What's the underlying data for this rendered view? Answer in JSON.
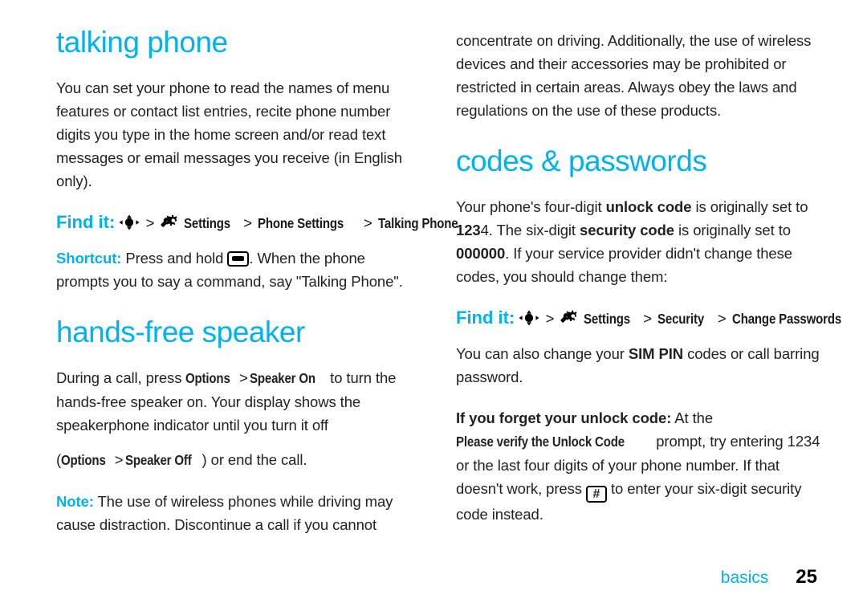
{
  "page": {
    "footer_label": "basics",
    "page_number": "25",
    "accent_color": "#00b2f0",
    "text_color": "#222222"
  },
  "left_column": {
    "heading_talking_phone": "talking phone",
    "intro_paragraph": "You can set your phone to read the names of menu features or contact list entries, recite phone number digits you type in the home screen and/or read text messages or email messages you receive (in English only).",
    "find_it": {
      "label": "Find it:",
      "dpad_icon": "dpad-navigation-icon",
      "sep1": ">",
      "settings_icon": "settings-wrench-gear-icon",
      "item_settings": "Settings",
      "sep2": ">",
      "item_phone_settings": "Phone Settings",
      "sep3": ">",
      "item_talking_phone": "Talking Phone"
    },
    "shortcut": {
      "label": "Shortcut:",
      "text_before": "Press and hold",
      "key_icon": "phone-bar-key-icon",
      "text_after": ". When the phone prompts you to say a command, say \"Talking Phone\"."
    },
    "heading_hands_free": "hands-free speaker",
    "hands_free": {
      "part1": "During a call, press ",
      "menu_options": "Options",
      "sep1": ">",
      "menu_speaker_on": "Speaker On",
      "part2": " to turn the hands-free speaker on. Your display shows the speakerphone indicator until you turn it off"
    },
    "speaker_off_line": {
      "open_paren": "(",
      "menu_options": "Options",
      "sep": ">",
      "menu_speaker_off": "Speaker Off",
      "close_text": ") or end the call."
    },
    "note": {
      "label": "Note:",
      "text": " The use of wireless phones while driving may cause distraction. Discontinue a call if you cannot"
    }
  },
  "right_column": {
    "continued_paragraph": "concentrate on driving. Additionally, the use of wireless devices and their accessories may be prohibited or restricted in certain areas. Always obey the laws and regulations on the use of these products.",
    "heading_codes_passwords": "codes & passwords",
    "codes_paragraph": {
      "p1": "Your phone's four-digit ",
      "bold1": "unlock code",
      "p2": " is originally set to ",
      "bold_code_part": "123",
      "code_tail": "4",
      "p3": ". The six-digit ",
      "bold2": "security code",
      "p4": " is originally set to ",
      "bold3": "000000",
      "p5": ". If your service provider didn't change these codes, you should change them:"
    },
    "find_it": {
      "label": "Find it:",
      "dpad_icon": "dpad-navigation-icon",
      "sep1": ">",
      "settings_icon": "settings-wrench-gear-icon",
      "item_settings": "Settings",
      "sep2": ">",
      "item_security": "Security",
      "sep3": ">",
      "item_change_passwords": "Change Passwords"
    },
    "sim_pin_paragraph": {
      "p1": "You can also change your ",
      "bold1": "SIM PIN",
      "p2": " codes or call barring password."
    },
    "forgot_paragraph": {
      "bold_lead": "If you forget your unlock code:",
      "p1": " At the ",
      "ui_label1": "Please verify the Unlock Code",
      "p2": " prompt, try entering 1234 or the last four digits of your phone number. If that doesn't work, press ",
      "key_icon": "phone-hash-key-icon",
      "p3": " to enter your six-digit security code instead."
    }
  }
}
